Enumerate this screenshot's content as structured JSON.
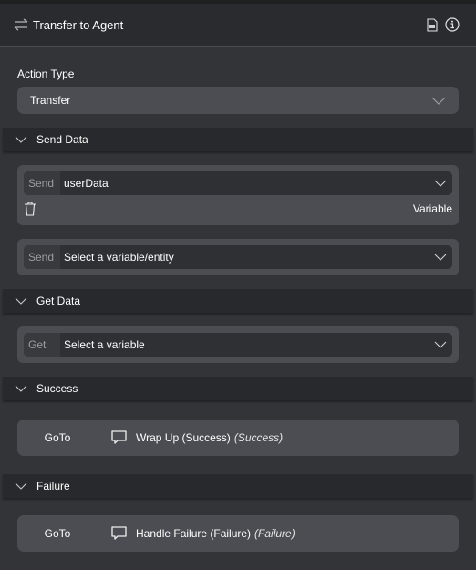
{
  "header": {
    "title": "Transfer to Agent",
    "title_icon": "transfer-arrows-icon",
    "actions": [
      "document-icon",
      "info-icon"
    ]
  },
  "action_type": {
    "label": "Action Type",
    "value": "Transfer"
  },
  "send_data": {
    "section_label": "Send Data",
    "items": [
      {
        "prefix": "Send",
        "value": "userData",
        "type_label": "Variable"
      },
      {
        "prefix": "Send",
        "value": "Select a variable/entity"
      }
    ]
  },
  "get_data": {
    "section_label": "Get Data",
    "items": [
      {
        "prefix": "Get",
        "value": "Select a variable"
      }
    ]
  },
  "success": {
    "section_label": "Success",
    "goto_label": "GoTo",
    "target": "Wrap Up (Success)",
    "target_note": "(Success)"
  },
  "failure": {
    "section_label": "Failure",
    "goto_label": "GoTo",
    "target": "Handle Failure (Failure)",
    "target_note": "(Failure)"
  }
}
